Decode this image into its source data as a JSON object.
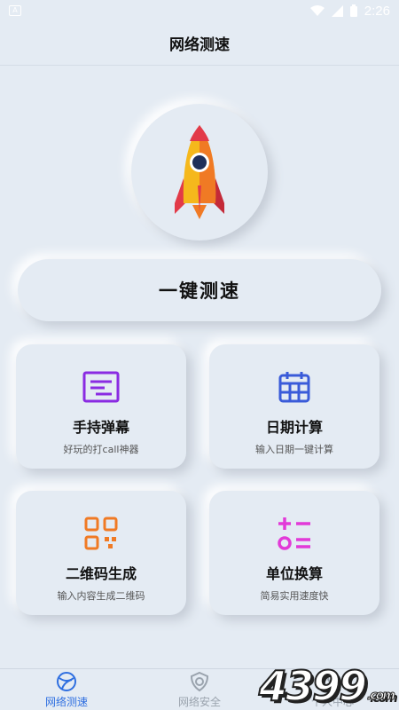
{
  "status_bar": {
    "time": "2:26",
    "left_icon": "A"
  },
  "header": {
    "title": "网络测速"
  },
  "hero": {
    "icon": "rocket-icon"
  },
  "speed_button": {
    "label": "一键测速"
  },
  "cards": [
    {
      "title": "手持弹幕",
      "subtitle": "好玩的打call神器",
      "icon": "screen-text-icon",
      "color": "#8a2be2"
    },
    {
      "title": "日期计算",
      "subtitle": "输入日期一键计算",
      "icon": "calendar-icon",
      "color": "#3a5bd9"
    },
    {
      "title": "二维码生成",
      "subtitle": "输入内容生成二维码",
      "icon": "qrcode-icon",
      "color": "#f07a24"
    },
    {
      "title": "单位换算",
      "subtitle": "简易实用速度快",
      "icon": "calculator-icon",
      "color": "#e23ad8"
    }
  ],
  "tabs": [
    {
      "label": "网络测速",
      "icon": "globe-icon",
      "active": true
    },
    {
      "label": "网络安全",
      "icon": "shield-icon",
      "active": false
    },
    {
      "label": "个人中心",
      "icon": "user-icon",
      "active": false
    }
  ],
  "watermark": {
    "text": "4399",
    "suffix": ".com"
  },
  "colors": {
    "background": "#e4ebf3",
    "active_tab": "#2f6fe0",
    "inactive_tab": "#9aa3ad"
  }
}
